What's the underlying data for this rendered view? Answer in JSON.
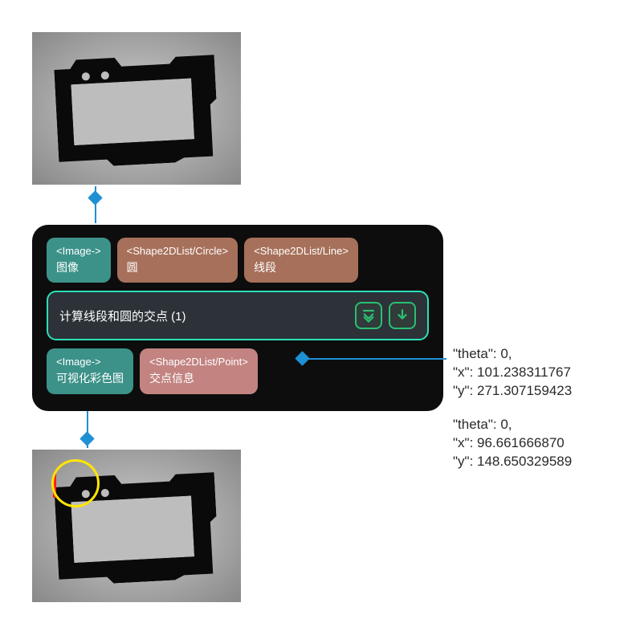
{
  "node": {
    "title": "计算线段和圆的交点 (1)",
    "inputs": [
      {
        "type": "<Image->",
        "label": "图像",
        "color": "teal"
      },
      {
        "type": "<Shape2DList/Circle>",
        "label": "圆",
        "color": "brown"
      },
      {
        "type": "<Shape2DList/Line>",
        "label": "线段",
        "color": "brown"
      }
    ],
    "outputs": [
      {
        "type": "<Image->",
        "label": "可视化彩色图",
        "color": "teal"
      },
      {
        "type": "<Shape2DList/Point>",
        "label": "交点信息",
        "color": "salmon"
      }
    ]
  },
  "points": [
    {
      "theta_label": "\"theta\": 0,",
      "x_label": "\"x\": 101.238311767",
      "y_label": "\"y\": 271.307159423"
    },
    {
      "theta_label": "\"theta\": 0,",
      "x_label": "\"x\": 96.661666870",
      "y_label": "\"y\": 148.650329589"
    }
  ],
  "icons": {
    "expand": "expand-icon",
    "run": "run-icon"
  }
}
